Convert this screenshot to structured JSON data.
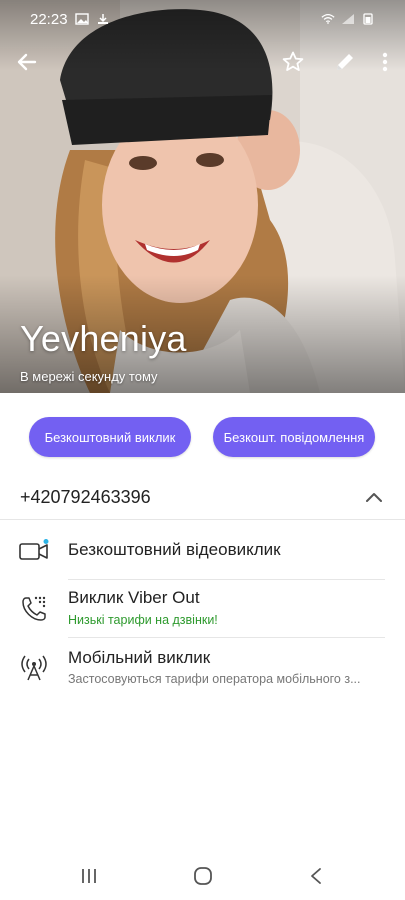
{
  "status_bar": {
    "time": "22:23"
  },
  "profile": {
    "name": "Yevheniya",
    "status": "В мережі секунду тому"
  },
  "actions": {
    "free_call": "Безкоштовний виклик",
    "free_message": "Безкошт. повідомлення"
  },
  "phone": {
    "number": "+420792463396"
  },
  "options": [
    {
      "title": "Безкоштовний відеовиклик",
      "icon": "video-camera-icon"
    },
    {
      "title": "Виклик Viber Out",
      "subtitle": "Низькі тарифи на дзвінки!",
      "icon": "phone-keypad-icon"
    },
    {
      "title": "Мобільний виклик",
      "subtitle": "Застосовуються тарифи оператора мобільного з...",
      "icon": "antenna-icon"
    }
  ],
  "colors": {
    "accent": "#7360f2",
    "green": "#2e9a2e",
    "notification_dot": "#2bb3e6"
  }
}
